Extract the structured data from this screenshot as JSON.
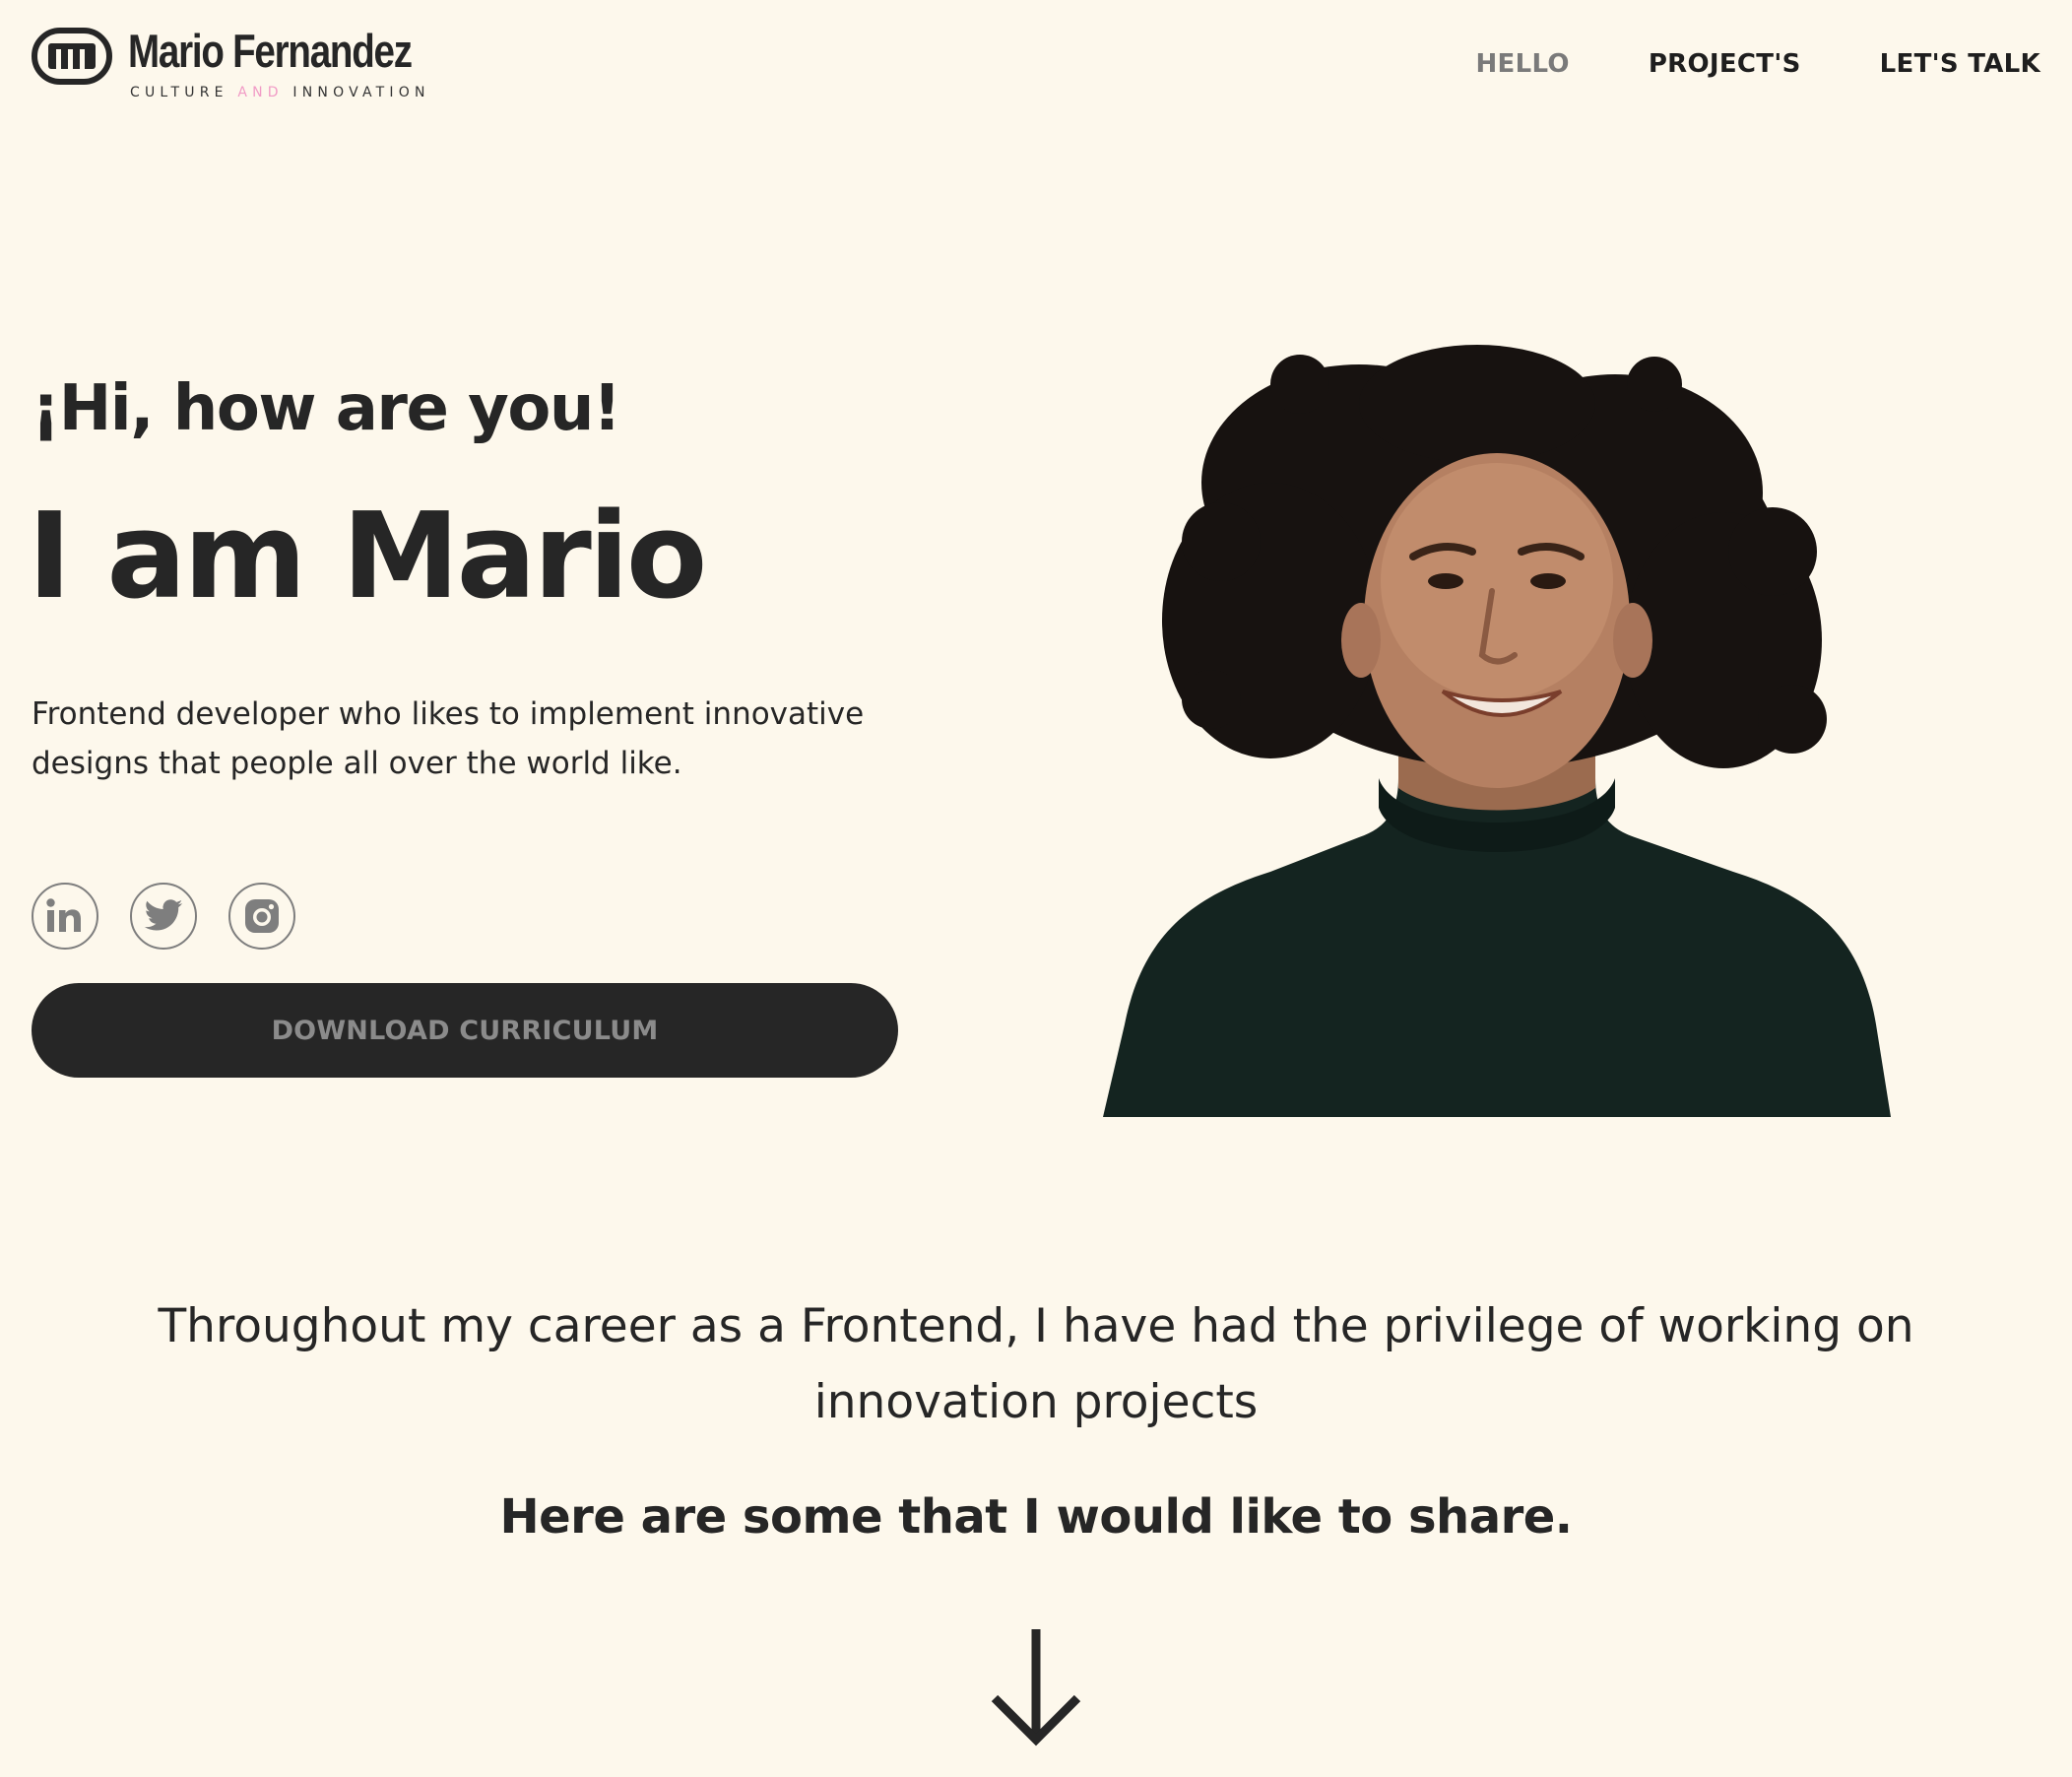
{
  "brand": {
    "name": "Mario Fernandez",
    "tagline_part1": "CULTURE",
    "tagline_accent": "AND",
    "tagline_part2": "INNOVATION",
    "accent_color": "#f19bc6"
  },
  "nav": {
    "items": [
      {
        "label": "HELLO",
        "active": true
      },
      {
        "label": "PROJECT'S",
        "active": false
      },
      {
        "label": "LET'S TALK",
        "active": false
      }
    ]
  },
  "hero": {
    "greeting": "¡Hi, how are you!",
    "title": "I am Mario",
    "description": "Frontend developer who likes to implement innovative designs that people all over the world like.",
    "socials": [
      {
        "icon": "linkedin-icon"
      },
      {
        "icon": "twitter-icon"
      },
      {
        "icon": "instagram-icon"
      }
    ],
    "cta_label": "DOWNLOAD CURRICULUM"
  },
  "intro": {
    "text": "Throughout my career as a Frontend, I have had the privilege of working on innovation projects",
    "share_text": "Here are some that I would like to share."
  },
  "colors": {
    "background": "#fdf8ec",
    "text": "#262626",
    "button_bg": "#262626",
    "button_text": "#8b8b8b",
    "sweater": "#142420",
    "hair": "#171210"
  }
}
